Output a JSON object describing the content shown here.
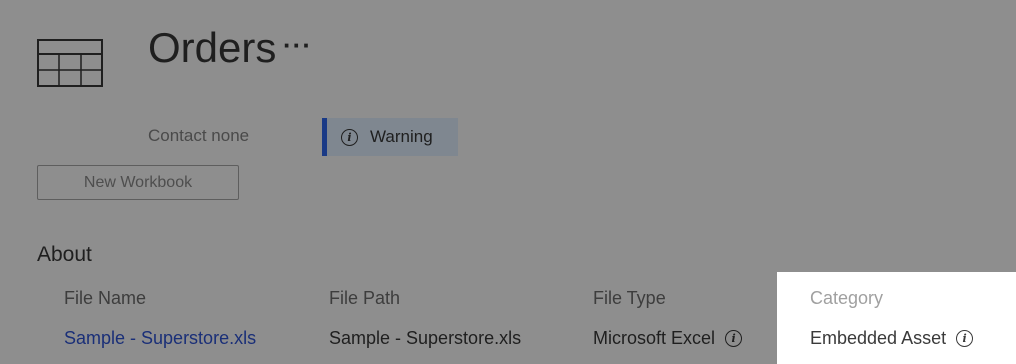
{
  "header": {
    "icon": "table-icon",
    "title": "Orders",
    "more_label": "···",
    "contact": "Contact  none",
    "warning": {
      "icon": "info-icon",
      "label": "Warning"
    }
  },
  "actions": {
    "new_workbook_label": "New Workbook"
  },
  "about": {
    "heading": "About",
    "file_name": {
      "label": "File Name",
      "value": "Sample - Superstore.xls"
    },
    "file_path": {
      "label": "File Path",
      "value": "Sample - Superstore.xls"
    },
    "file_type": {
      "label": "File Type",
      "value": "Microsoft Excel",
      "icon": "info-icon"
    },
    "category": {
      "label": "Category",
      "value": "Embedded Asset",
      "icon": "info-icon"
    }
  },
  "colors": {
    "background": "#8e8e8e",
    "highlight": "#ffffff",
    "warning_accent": "#1a3a86",
    "link": "#1a2f78"
  }
}
